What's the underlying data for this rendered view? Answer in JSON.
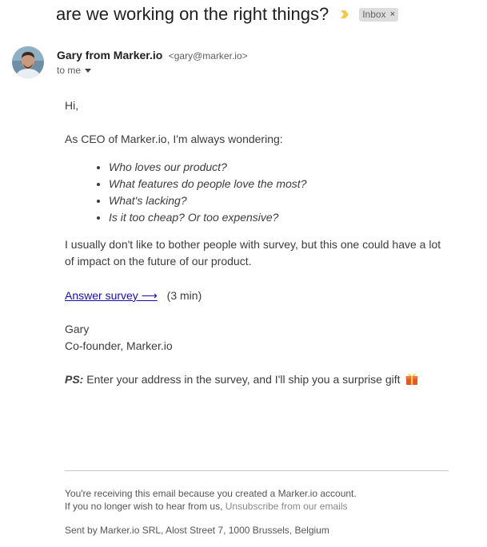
{
  "email": {
    "subject": "are we working on the right things?",
    "label_chip": "Inbox",
    "label_close": "×",
    "sender_name": "Gary from Marker.io",
    "sender_email": "<gary@marker.io>",
    "recipient": "to me"
  },
  "body": {
    "greeting": "Hi,",
    "intro": "As CEO of Marker.io, I'm always wondering:",
    "questions": [
      "Who loves our product?",
      "What features do people love the most?",
      "What's lacking?",
      "Is it too cheap? Or too expensive?"
    ],
    "paragraph": "I usually don't like to bother people with survey, but this one could have a lot of impact on the future of our product.",
    "survey_link": "Answer survey ⟶",
    "survey_duration": "(3 min)",
    "signature_name": "Gary",
    "signature_title": "Co-founder, Marker.io",
    "ps_label": "PS:",
    "ps_text": " Enter your address in the survey, and I'll ship you a surprise gift"
  },
  "footer": {
    "reason": "You're receiving this email because you created a Marker.io account.",
    "optout_prefix": "If you no longer wish to hear from us, ",
    "unsubscribe_link": "Unsubscribe from our emails",
    "address": "Sent by Marker.io SRL, Alost Street 7, 1000 Brussels, Belgium"
  },
  "colors": {
    "link": "#1a0dab",
    "importance_marker": "#f2c94c",
    "chip_bg": "#dddddd"
  },
  "icons": {
    "importance": "importance-marker-icon",
    "dropdown": "chevron-down-icon",
    "gift": "gift-icon",
    "avatar": "sender-avatar"
  }
}
